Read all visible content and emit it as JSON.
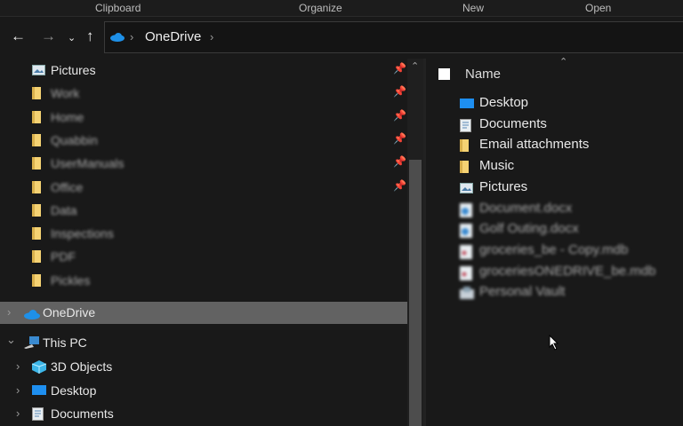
{
  "ribbon": {
    "groups": [
      "Clipboard",
      "Organize",
      "New",
      "Open"
    ]
  },
  "address": {
    "crumbs": [
      "OneDrive"
    ]
  },
  "nav": {
    "quick_access": [
      {
        "label": "Pictures",
        "icon": "pictures-icon",
        "pinned": true,
        "blurred": false
      },
      {
        "label": "Work",
        "icon": "folder-icon",
        "pinned": true,
        "blurred": true
      },
      {
        "label": "Home",
        "icon": "folder-icon",
        "pinned": true,
        "blurred": true
      },
      {
        "label": "Quabbin",
        "icon": "folder-icon",
        "pinned": true,
        "blurred": true
      },
      {
        "label": "UserManuals",
        "icon": "folder-icon",
        "pinned": true,
        "blurred": true
      },
      {
        "label": "Office",
        "icon": "folder-icon",
        "pinned": true,
        "blurred": true
      },
      {
        "label": "Data",
        "icon": "folder-icon",
        "pinned": false,
        "blurred": true
      },
      {
        "label": "Inspections",
        "icon": "folder-icon",
        "pinned": false,
        "blurred": true
      },
      {
        "label": "PDF",
        "icon": "folder-icon",
        "pinned": false,
        "blurred": true
      },
      {
        "label": "Pickles",
        "icon": "folder-icon",
        "pinned": false,
        "blurred": true
      }
    ],
    "onedrive": {
      "label": "OneDrive",
      "selected": true
    },
    "this_pc": {
      "label": "This PC",
      "expanded": true
    },
    "this_pc_items": [
      {
        "label": "3D Objects",
        "icon": "3d-objects-icon"
      },
      {
        "label": "Desktop",
        "icon": "desktop-icon"
      },
      {
        "label": "Documents",
        "icon": "documents-icon"
      }
    ]
  },
  "content": {
    "column_header": "Name",
    "items": [
      {
        "label": "Desktop",
        "icon": "desktop-icon",
        "blurred": false
      },
      {
        "label": "Documents",
        "icon": "documents-icon",
        "blurred": false
      },
      {
        "label": "Email attachments",
        "icon": "folder-icon",
        "blurred": false
      },
      {
        "label": "Music",
        "icon": "folder-icon",
        "blurred": false
      },
      {
        "label": "Pictures",
        "icon": "pictures-icon",
        "blurred": false
      },
      {
        "label": "Document.docx",
        "icon": "word-file-icon",
        "blurred": true
      },
      {
        "label": "Golf Outing.docx",
        "icon": "word-file-icon",
        "blurred": true
      },
      {
        "label": "groceries_be - Copy.mdb",
        "icon": "access-file-icon",
        "blurred": true
      },
      {
        "label": "groceriesONEDRIVE_be.mdb",
        "icon": "access-file-icon",
        "blurred": true
      },
      {
        "label": "Personal Vault",
        "icon": "personal-vault-icon",
        "blurred": true
      }
    ]
  },
  "colors": {
    "selected_row": "#626262",
    "onedrive_blue": "#1e90e8",
    "folder_yellow": "#f5d273"
  }
}
